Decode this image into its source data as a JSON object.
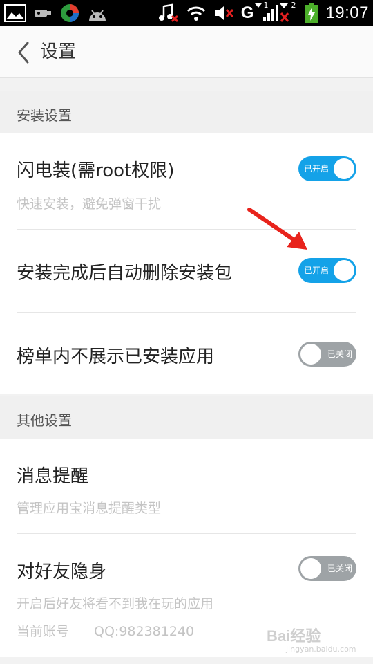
{
  "status_bar": {
    "time": "19:07",
    "network_letter": "G",
    "sim2_label": "2",
    "sim1_label": "1",
    "icons": [
      "gallery-icon",
      "usb-icon",
      "app-icon",
      "android-icon",
      "music-muted-icon",
      "wifi-icon",
      "volume-muted-icon",
      "signal-icon",
      "signal-muted-icon",
      "battery-charging-icon"
    ]
  },
  "header": {
    "title": "设置",
    "back_icon": "chevron-left-icon"
  },
  "sections": {
    "install": {
      "title": "安装设置",
      "items": [
        {
          "title": "闪电装(需root权限)",
          "subtitle": "快速安装，避免弹窗干扰",
          "toggle_state": "on",
          "toggle_label": "已开启"
        },
        {
          "title": "安装完成后自动删除安装包",
          "toggle_state": "on",
          "toggle_label": "已开启"
        },
        {
          "title": "榜单内不展示已安装应用",
          "toggle_state": "off",
          "toggle_label": "已关闭"
        }
      ]
    },
    "other": {
      "title": "其他设置",
      "items": [
        {
          "title": "消息提醒",
          "subtitle": "管理应用宝消息提醒类型"
        },
        {
          "title": "对好友隐身",
          "subtitle": "开启后好友将看不到我在玩的应用",
          "toggle_state": "off",
          "toggle_label": "已关闭"
        }
      ],
      "account_label": "当前账号",
      "account_value": "QQ:982381240"
    }
  },
  "watermark": {
    "text": "Bai经验",
    "sub": "jingyan.baidu.com"
  },
  "colors": {
    "toggle_on": "#14a2e8",
    "toggle_off": "#9ea3a6",
    "arrow": "#e8231c"
  }
}
